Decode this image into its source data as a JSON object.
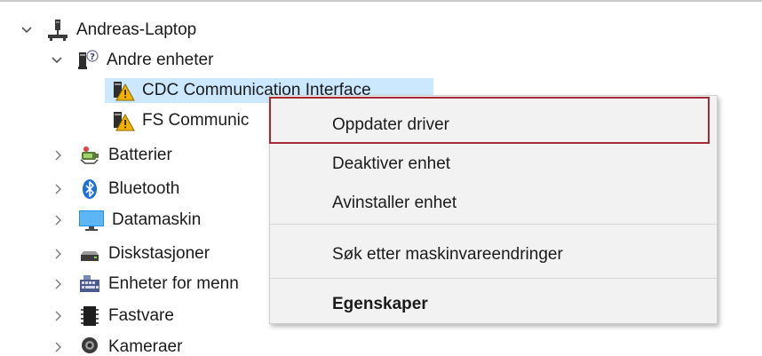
{
  "tree": {
    "root": {
      "label": "Andreas-Laptop",
      "expanded": true,
      "icon": "computer-root-icon"
    },
    "other_devices": {
      "label": "Andre enheter",
      "expanded": true,
      "icon": "unknown-device-icon",
      "children": [
        {
          "label": "CDC Communication Interface",
          "icon": "device-warning-icon",
          "selected": true
        },
        {
          "label": "FS Communic",
          "icon": "device-warning-icon"
        }
      ]
    },
    "categories": [
      {
        "label": "Batterier",
        "icon": "battery-icon"
      },
      {
        "label": "Bluetooth",
        "icon": "bluetooth-icon"
      },
      {
        "label": "Datamaskin",
        "icon": "monitor-icon"
      },
      {
        "label": "Diskstasjoner",
        "icon": "disk-drive-icon"
      },
      {
        "label": "Enheter for menn",
        "icon": "hid-device-icon"
      },
      {
        "label": "Fastvare",
        "icon": "firmware-icon"
      },
      {
        "label": "Kameraer",
        "icon": "camera-icon"
      }
    ]
  },
  "context_menu": {
    "items": [
      {
        "label": "Oppdater driver",
        "highlighted": true
      },
      {
        "label": "Deaktiver enhet"
      },
      {
        "label": "Avinstaller enhet"
      },
      {
        "label": "Søk etter maskinvareendringer"
      },
      {
        "label": "Egenskaper",
        "bold": true
      }
    ]
  },
  "colors": {
    "selection": "#cce8ff",
    "highlight_border": "#a52a35",
    "menu_background": "#f2f2f2"
  }
}
